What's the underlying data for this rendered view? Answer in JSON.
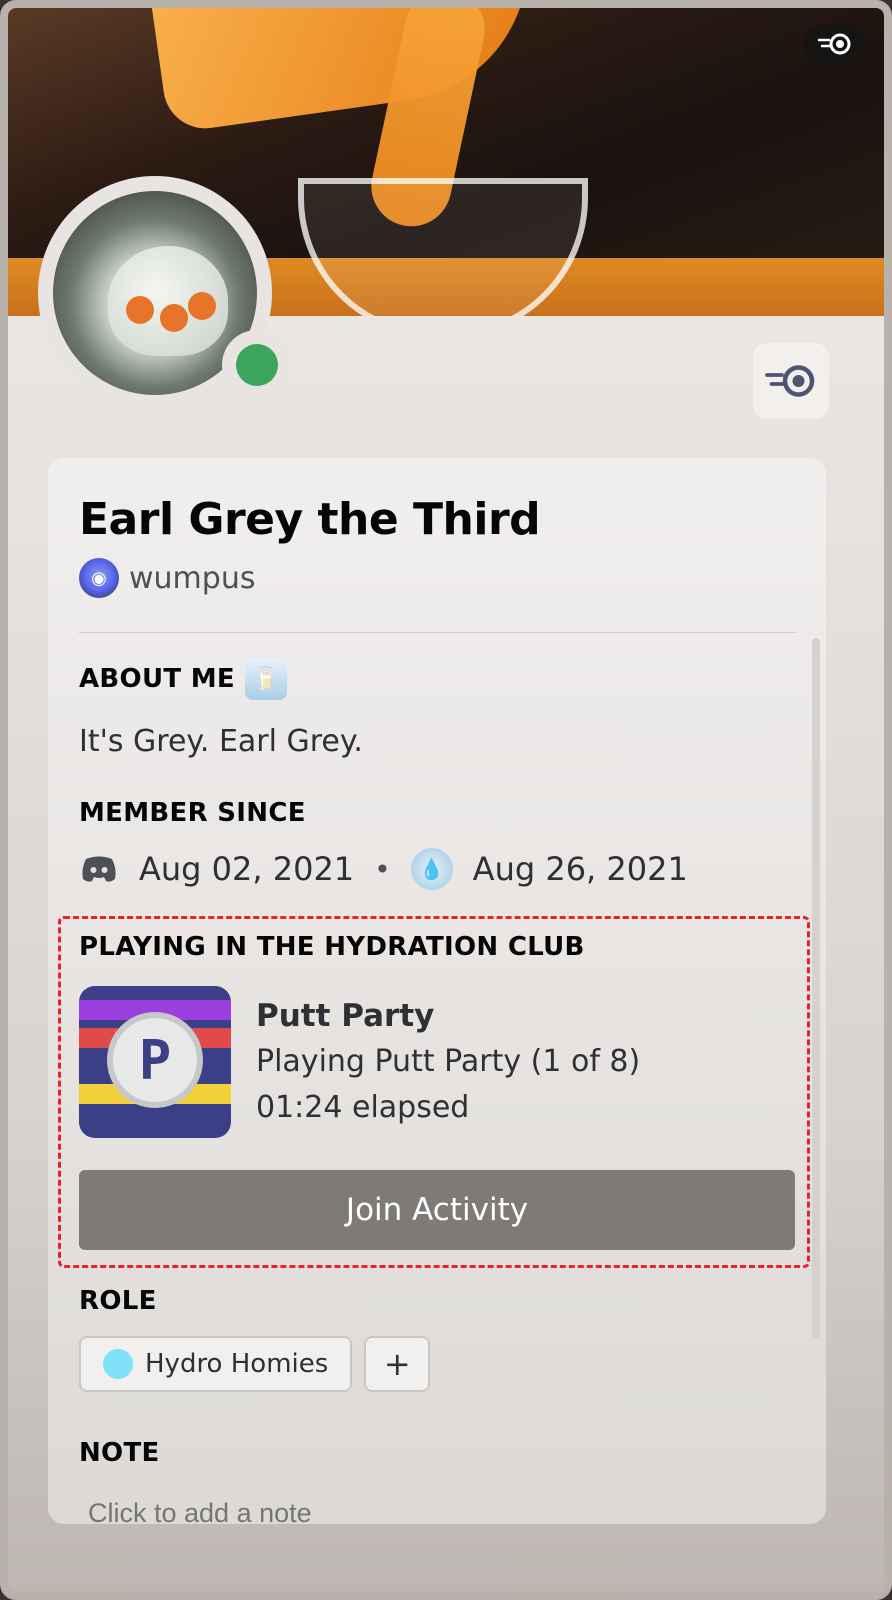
{
  "profile": {
    "display_name": "Earl Grey the Third",
    "username": "wumpus",
    "status": "online",
    "status_color": "#3ba55d",
    "badge_icon": "nitro-icon"
  },
  "about": {
    "title": "ABOUT ME",
    "text": "It's Grey. Earl Grey."
  },
  "member_since": {
    "title": "MEMBER SINCE",
    "discord_date": "Aug 02, 2021",
    "separator": "•",
    "server_date": "Aug 26, 2021"
  },
  "activity": {
    "title": "PLAYING IN THE HYDRATION CLUB",
    "game_name": "Putt Party",
    "detail": "Playing Putt Party (1 of 8)",
    "elapsed": "01:24 elapsed",
    "art_letter": "P",
    "join_label": "Join Activity",
    "highlight_color": "#e8222a"
  },
  "role": {
    "title": "ROLE",
    "items": [
      {
        "label": "Hydro Homies",
        "color": "#7ee1f8"
      }
    ],
    "add_label": "+"
  },
  "note": {
    "title": "NOTE",
    "placeholder": "Click to add a note"
  }
}
